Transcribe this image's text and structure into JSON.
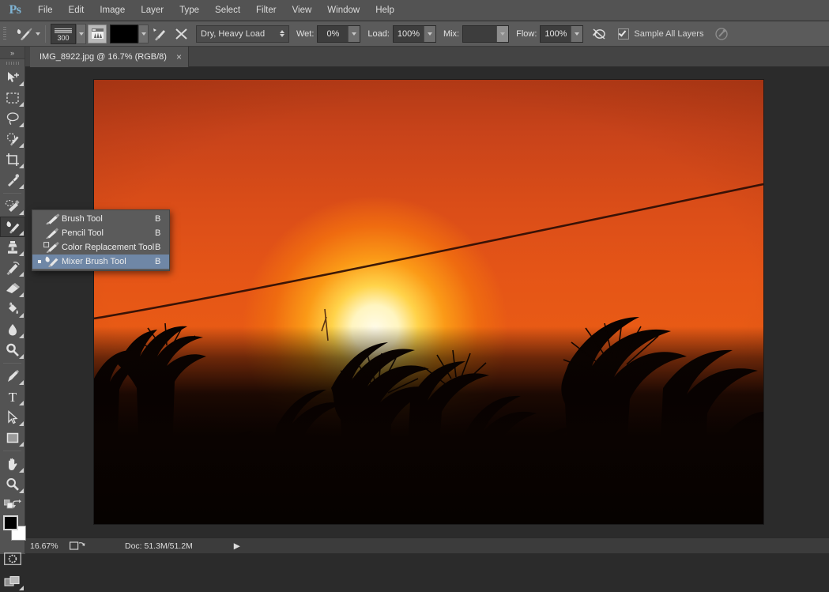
{
  "app": {
    "name": "Adobe Photoshop",
    "logo_text": "Ps",
    "logo_color": "#7fb4d4"
  },
  "menubar": {
    "items": [
      {
        "label": "File"
      },
      {
        "label": "Edit"
      },
      {
        "label": "Image"
      },
      {
        "label": "Layer"
      },
      {
        "label": "Type"
      },
      {
        "label": "Select"
      },
      {
        "label": "Filter"
      },
      {
        "label": "View"
      },
      {
        "label": "Window"
      },
      {
        "label": "Help"
      }
    ]
  },
  "options_bar": {
    "tool_preset_icon": "mixer-brush-icon",
    "brush_size": "300",
    "brush_panel_icon": "brush-panel-icon",
    "color_swatch": "#000000",
    "load_brush_icon": "load-brush-after-stroke-icon",
    "clean_brush_icon": "clean-brush-after-stroke-icon",
    "blend_preset": "Dry, Heavy Load",
    "wet_label": "Wet:",
    "wet_value": "0%",
    "load_label": "Load:",
    "load_value": "100%",
    "mix_label": "Mix:",
    "mix_value": "",
    "flow_label": "Flow:",
    "flow_value": "100%",
    "airbrush_icon": "airbrush-icon",
    "sample_all_layers_label": "Sample All Layers",
    "sample_all_layers_checked": true,
    "tablet_pressure_icon": "tablet-pressure-icon"
  },
  "document_tab": {
    "title": "IMG_8922.jpg @ 16.7% (RGB/8)",
    "close_label": "×"
  },
  "toolbar": {
    "expand_label": "»",
    "tools": [
      {
        "name": "move-tool",
        "has_submenu": true
      },
      {
        "name": "rectangular-marquee-tool",
        "has_submenu": true
      },
      {
        "name": "lasso-tool",
        "has_submenu": true
      },
      {
        "name": "quick-selection-tool",
        "has_submenu": true
      },
      {
        "name": "crop-tool",
        "has_submenu": true
      },
      {
        "name": "eyedropper-tool",
        "has_submenu": true
      },
      {
        "name": "spot-healing-brush-tool",
        "has_submenu": true
      },
      {
        "name": "mixer-brush-tool",
        "has_submenu": true,
        "active": true
      },
      {
        "name": "clone-stamp-tool",
        "has_submenu": true
      },
      {
        "name": "history-brush-tool",
        "has_submenu": true
      },
      {
        "name": "eraser-tool",
        "has_submenu": true
      },
      {
        "name": "gradient-tool",
        "has_submenu": true
      },
      {
        "name": "blur-tool",
        "has_submenu": true
      },
      {
        "name": "dodge-tool",
        "has_submenu": true
      },
      {
        "name": "pen-tool",
        "has_submenu": true
      },
      {
        "name": "horizontal-type-tool",
        "has_submenu": true
      },
      {
        "name": "path-selection-tool",
        "has_submenu": true
      },
      {
        "name": "rectangle-tool",
        "has_submenu": true
      },
      {
        "name": "hand-tool",
        "has_submenu": true
      },
      {
        "name": "zoom-tool",
        "has_submenu": true
      }
    ],
    "foreground_color": "#000000",
    "background_color": "#ffffff",
    "quick_mask_name": "edit-in-quick-mask-mode",
    "screen_mode_name": "change-screen-mode"
  },
  "flyout_menu": {
    "items": [
      {
        "label": "Brush Tool",
        "shortcut": "B",
        "icon": "brush-tool-icon",
        "selected": false
      },
      {
        "label": "Pencil Tool",
        "shortcut": "B",
        "icon": "pencil-tool-icon",
        "selected": false
      },
      {
        "label": "Color Replacement Tool",
        "shortcut": "B",
        "icon": "color-replacement-tool-icon",
        "selected": false
      },
      {
        "label": "Mixer Brush Tool",
        "shortcut": "B",
        "icon": "mixer-brush-tool-icon",
        "selected": true
      }
    ],
    "highlight_color": "#6f87a6"
  },
  "canvas": {
    "image_description": "Sunset over silhouetted palm trees with a power line crossing the orange sky",
    "zoom_percent": "16.67%"
  },
  "statusbar": {
    "zoom": "16.67%",
    "doc_icon": "document-info-icon",
    "doc_info": "Doc: 51.3M/51.2M",
    "arrow": "▶"
  },
  "colors": {
    "menubar_bg": "#535353",
    "options_bg": "#5b5b5b",
    "tabbar_bg": "#444444",
    "workspace_bg": "#2b2b2b",
    "statusbar_bg": "#3c3c3c",
    "sky_top": "#b33a16",
    "sky_mid": "#e85a15",
    "sun_core": "#fffbe8",
    "foreground": "#0a0301"
  }
}
